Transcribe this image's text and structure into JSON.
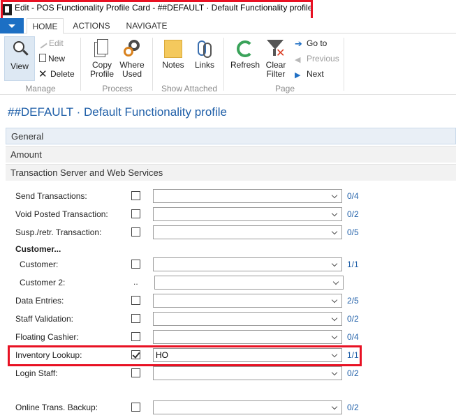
{
  "window": {
    "title": "Edit - POS Functionality Profile Card - ##DEFAULT · Default Functionality profile"
  },
  "ribbon": {
    "tabs": [
      "HOME",
      "ACTIONS",
      "NAVIGATE"
    ],
    "active_tab": "HOME",
    "manage": {
      "label": "Manage",
      "view": "View",
      "edit": "Edit",
      "new": "New",
      "delete": "Delete"
    },
    "process": {
      "label": "Process",
      "copy_profile_1": "Copy",
      "copy_profile_2": "Profile",
      "where_used_1": "Where",
      "where_used_2": "Used"
    },
    "show_attached": {
      "label": "Show Attached",
      "notes": "Notes",
      "links": "Links"
    },
    "page": {
      "label": "Page",
      "refresh": "Refresh",
      "clear_filter_1": "Clear",
      "clear_filter_2": "Filter",
      "go_to": "Go to",
      "previous": "Previous",
      "next": "Next"
    }
  },
  "page_title": "##DEFAULT · Default Functionality profile",
  "fasttabs": [
    "General",
    "Amount",
    "Transaction Server and Web Services"
  ],
  "fields": [
    {
      "label": "Send Transactions:",
      "checked": false,
      "value": "",
      "count": "0/4"
    },
    {
      "label": "Void Posted Transaction:",
      "checked": false,
      "value": "",
      "count": "0/2"
    },
    {
      "label": "Susp./retr. Transaction:",
      "checked": false,
      "value": "",
      "count": "0/5"
    },
    {
      "label": "Customer...",
      "group": true
    },
    {
      "label": "Customer:",
      "checked": false,
      "value": "",
      "count": "1/1"
    },
    {
      "label": "Customer 2:",
      "dots": "..",
      "value": ""
    },
    {
      "label": "Data Entries:",
      "checked": false,
      "value": "",
      "count": "2/5"
    },
    {
      "label": "Staff Validation:",
      "checked": false,
      "value": "",
      "count": "0/2"
    },
    {
      "label": "Floating Cashier:",
      "checked": false,
      "value": "",
      "count": "0/4"
    },
    {
      "label": "Inventory Lookup:",
      "checked": true,
      "value": "HO",
      "count": "1/1"
    },
    {
      "label": "Login Staff:",
      "checked": false,
      "value": "",
      "count": "0/2"
    },
    {
      "label": "Online Trans. Backup:",
      "checked": false,
      "value": "",
      "count": "0/2"
    }
  ]
}
